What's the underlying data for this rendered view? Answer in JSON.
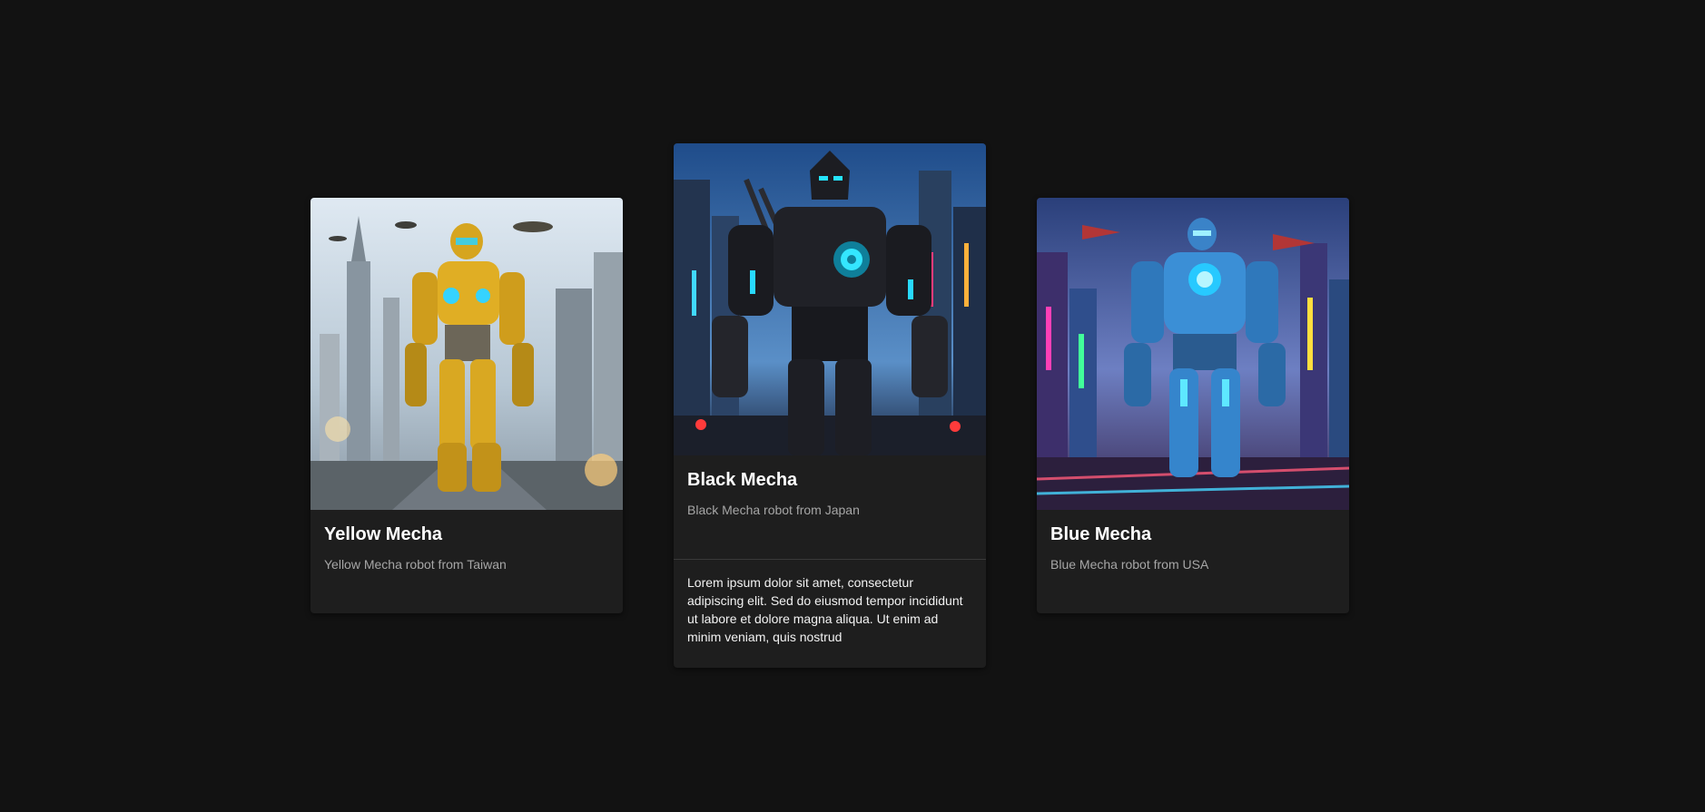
{
  "cards": [
    {
      "title": "Yellow Mecha",
      "subtitle": "Yellow Mecha robot from Taiwan",
      "image_icon": "yellow-mecha-robot-image",
      "accent": "#e6b52b"
    },
    {
      "title": "Black Mecha",
      "subtitle": "Black Mecha robot from Japan",
      "body": "Lorem ipsum dolor sit amet, consectetur adipiscing elit. Sed do eiusmod tempor incididunt ut labore et dolore magna aliqua. Ut enim ad minim veniam, quis nostrud",
      "image_icon": "black-mecha-robot-image",
      "accent": "#1ad8ff"
    },
    {
      "title": "Blue Mecha",
      "subtitle": "Blue Mecha robot from USA",
      "image_icon": "blue-mecha-robot-image",
      "accent": "#3b9be0"
    }
  ],
  "colors": {
    "page_background": "#121212",
    "card_background": "#1e1e1e",
    "title_text": "#ffffff",
    "subtitle_text": "#a6a6a6"
  }
}
